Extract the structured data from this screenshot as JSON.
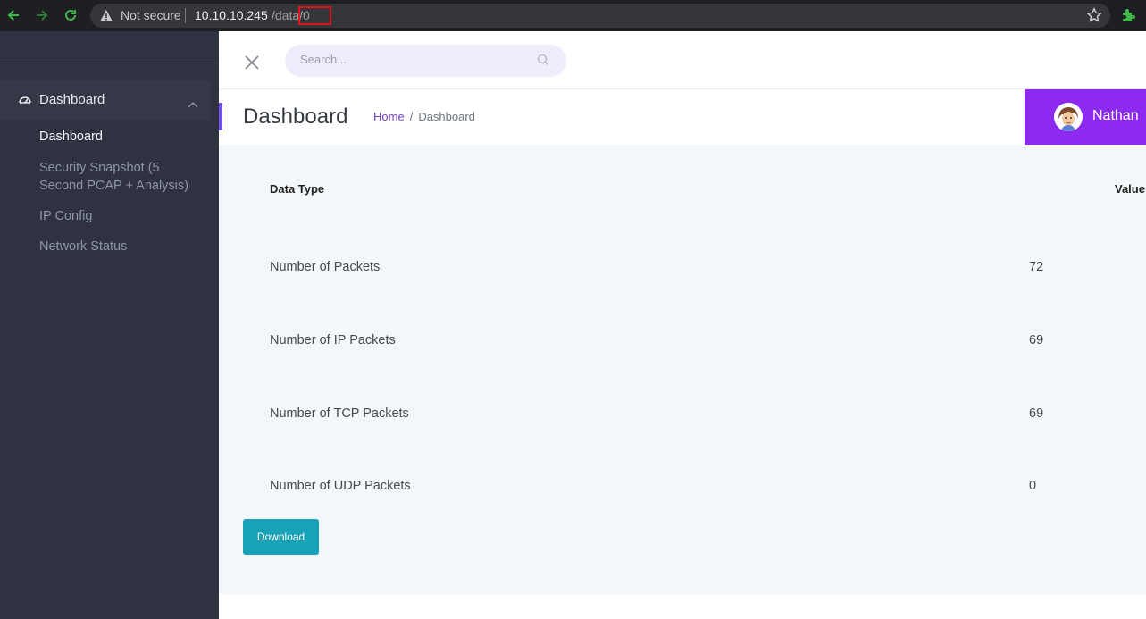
{
  "browser": {
    "security_label": "Not secure",
    "url_host": "10.10.10.245",
    "url_path": "/data/",
    "url_id": "0",
    "icons": [
      "back-arrow-icon",
      "forward-arrow-icon",
      "reload-icon",
      "warning-icon",
      "star-icon",
      "extension-puzzle-icon"
    ]
  },
  "sidebar": {
    "group": {
      "label": "Dashboard",
      "icon": "dashboard-gauge-icon"
    },
    "items": [
      {
        "label": "Dashboard",
        "active": true
      },
      {
        "label": "Security Snapshot (5",
        "label_line2": "Second PCAP + Analysis)",
        "active": false
      },
      {
        "label": "IP Config",
        "active": false
      },
      {
        "label": "Network Status",
        "active": false
      }
    ]
  },
  "topbar": {
    "search_placeholder": "Search..."
  },
  "page": {
    "title": "Dashboard",
    "breadcrumb": {
      "home": "Home",
      "separator": "/",
      "current": "Dashboard"
    }
  },
  "user": {
    "name": "Nathan"
  },
  "table": {
    "headers": {
      "type": "Data Type",
      "value": "Value"
    },
    "rows": [
      {
        "type": "Number of Packets",
        "value": "72"
      },
      {
        "type": "Number of IP Packets",
        "value": "69"
      },
      {
        "type": "Number of TCP Packets",
        "value": "69"
      },
      {
        "type": "Number of UDP Packets",
        "value": "0"
      }
    ]
  },
  "actions": {
    "download_label": "Download"
  },
  "colors": {
    "accent": "#7352f0",
    "user_box": "#8c2af0",
    "download": "#17a2b8",
    "sidebar": "#2e3241"
  }
}
